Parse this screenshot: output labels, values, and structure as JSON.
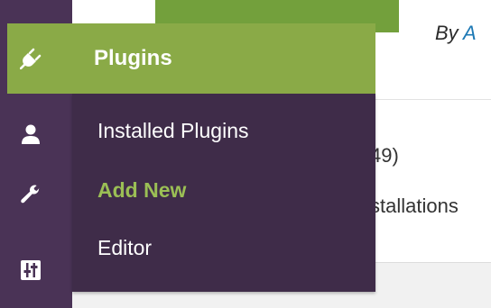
{
  "page": {
    "by_prefix": "By ",
    "author_fragment": "A",
    "rating_count": "49)",
    "installations_fragment": "stallations"
  },
  "sidebar": {
    "icons": [
      "plugin-icon",
      "user-icon",
      "wrench-icon",
      "sliders-icon"
    ],
    "active_color": "#8aaa47",
    "background_color": "#4a3356"
  },
  "flyout": {
    "title": "Plugins",
    "items": [
      {
        "label": "Installed Plugins",
        "current": false
      },
      {
        "label": "Add New",
        "current": true
      },
      {
        "label": "Editor",
        "current": false
      }
    ],
    "background_color": "#3f2c49",
    "current_color": "#9bbf55"
  }
}
